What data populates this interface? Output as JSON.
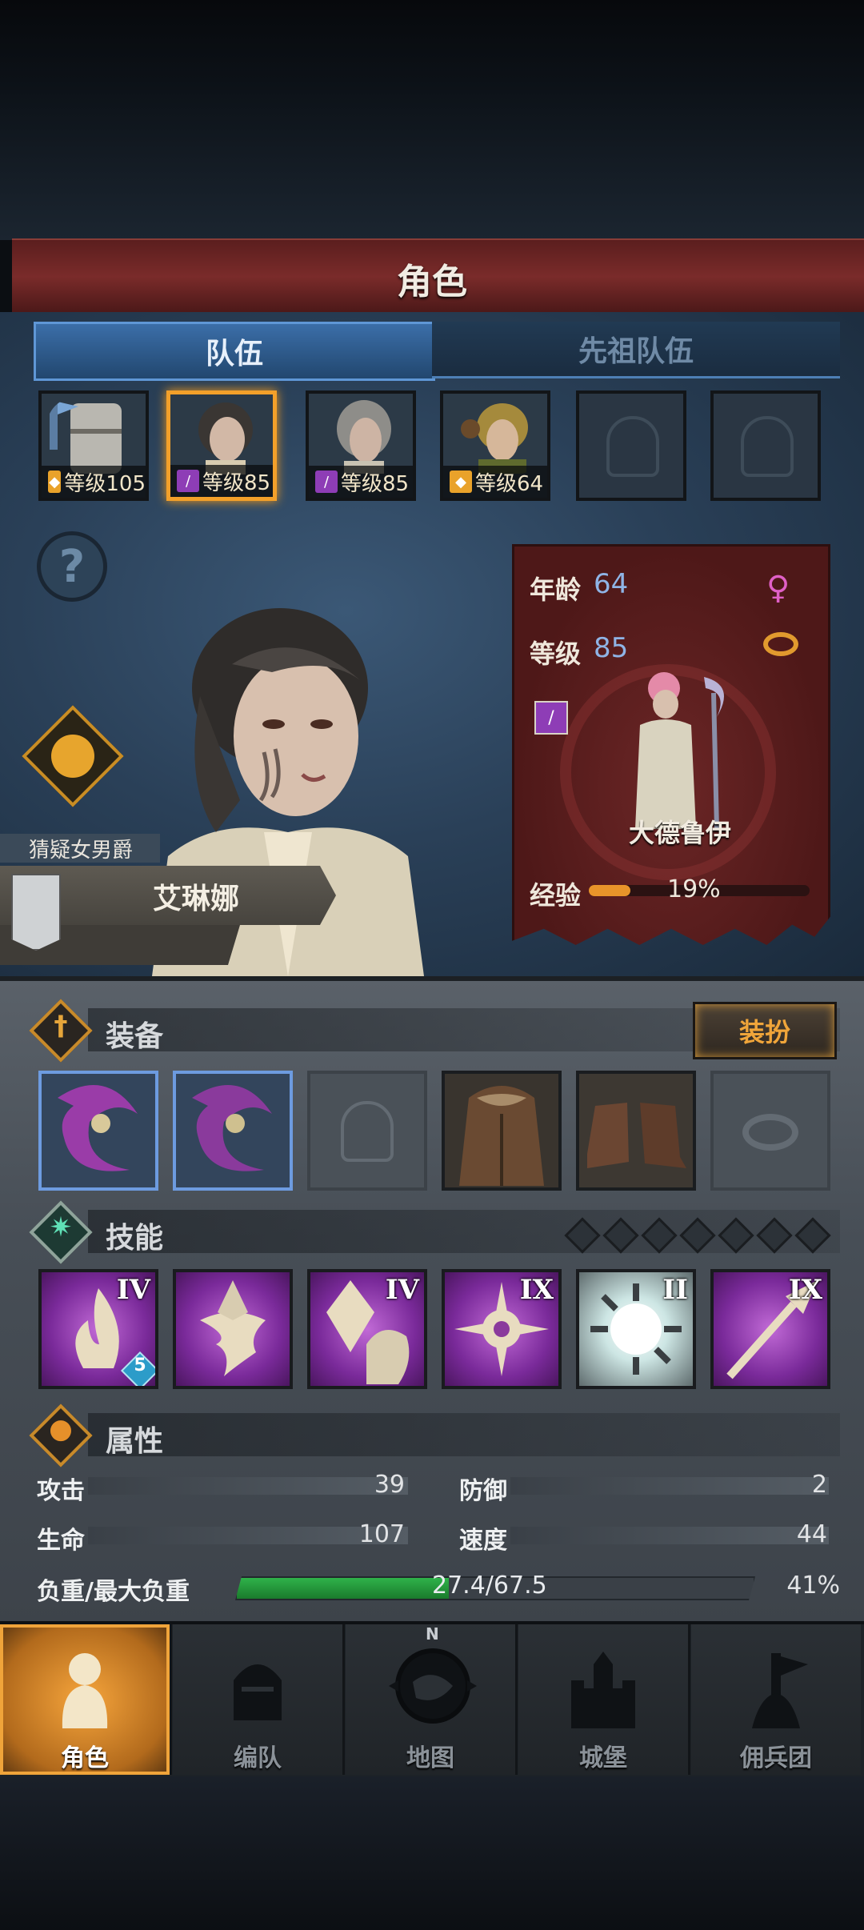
{
  "header": {
    "title": "角色"
  },
  "tabs": [
    {
      "label": "队伍",
      "active": true
    },
    {
      "label": "先祖队伍",
      "active": false
    }
  ],
  "roster": [
    {
      "level": "等级105",
      "class_icon": "shield-icon",
      "portrait": "armored-knight",
      "selected": false
    },
    {
      "level": "等级85",
      "class_icon": "staff-icon",
      "portrait": "dark-haired-woman",
      "selected": true
    },
    {
      "level": "等级85",
      "class_icon": "staff-icon",
      "portrait": "gray-haired-woman",
      "selected": false
    },
    {
      "level": "等级64",
      "class_icon": "shield-icon",
      "portrait": "blonde-man",
      "selected": false
    },
    {
      "level": "",
      "portrait": "empty-helmet-slot",
      "selected": false
    },
    {
      "level": "",
      "portrait": "empty-helmet-slot",
      "selected": false
    }
  ],
  "character": {
    "title": "猜疑女男爵",
    "name": "艾琳娜",
    "age_label": "年龄",
    "age": "64",
    "level_label": "等级",
    "level": "85",
    "class_name": "大德鲁伊",
    "exp_label": "经验",
    "exp_percent": "19%",
    "exp_fraction": 0.19,
    "gender_icon": "female-icon",
    "marriage_icon": "ring-icon"
  },
  "equipment": {
    "title": "装备",
    "dress_button": "装扮",
    "slots": [
      "purple-claw-weapon",
      "purple-claw-weapon",
      "empty-helmet",
      "fur-robe",
      "leather-boots",
      "empty-ring"
    ]
  },
  "skills": {
    "title": "技能",
    "slot_pips": 7,
    "items": [
      {
        "icon": "flame-icon",
        "rank": "IV",
        "badge": "5"
      },
      {
        "icon": "tornado-icon",
        "rank": "",
        "badge": ""
      },
      {
        "icon": "crystal-hand-icon",
        "rank": "IV",
        "badge": ""
      },
      {
        "icon": "crosshair-burst-icon",
        "rank": "IX",
        "badge": ""
      },
      {
        "icon": "frost-burst-icon",
        "rank": "II",
        "badge": ""
      },
      {
        "icon": "spear-icon",
        "rank": "IX",
        "badge": ""
      }
    ]
  },
  "attributes": {
    "title": "属性",
    "attack_label": "攻击",
    "attack": "39",
    "defense_label": "防御",
    "defense": "2",
    "hp_label": "生命",
    "hp": "107",
    "speed_label": "速度",
    "speed": "44",
    "load_label": "负重/最大负重",
    "load_value": "27.4/67.5",
    "load_percent": "41%",
    "load_fraction": 0.41
  },
  "nav": [
    {
      "label": "角色",
      "icon": "knight-icon",
      "active": true
    },
    {
      "label": "编队",
      "icon": "helmet-icon",
      "active": false
    },
    {
      "label": "地图",
      "icon": "compass-map-icon",
      "active": false
    },
    {
      "label": "城堡",
      "icon": "castle-icon",
      "active": false
    },
    {
      "label": "佣兵团",
      "icon": "mercenary-icon",
      "active": false
    }
  ],
  "compass_letter": "N",
  "colors": {
    "accent": "#f3a02a",
    "tab_blue": "#3b6ea8",
    "card_red": "#5a1d1d",
    "load_green": "#2fb24a"
  }
}
